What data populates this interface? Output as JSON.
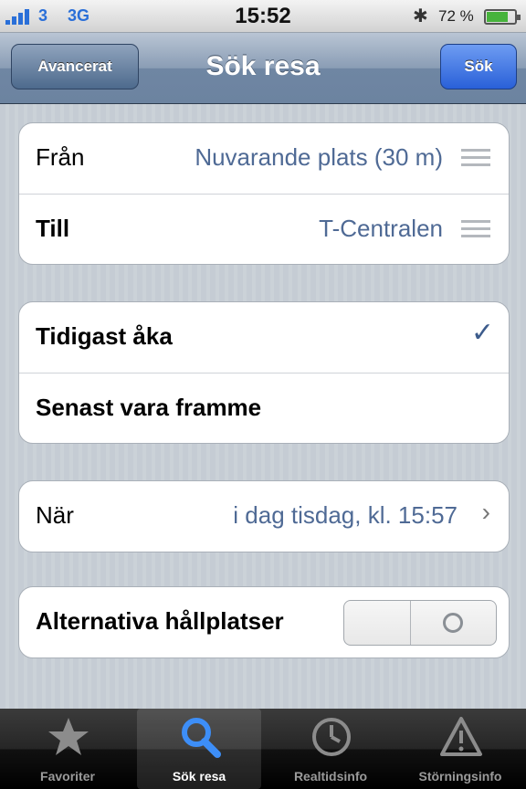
{
  "status": {
    "carrier": "3",
    "network": "3G",
    "time": "15:52",
    "battery": "72 %"
  },
  "nav": {
    "title": "Sök resa",
    "advanced_label": "Avancerat",
    "search_label": "Sök"
  },
  "route": {
    "from_label": "Från",
    "from_value": "Nuvarande plats (30 m)",
    "to_label": "Till",
    "to_value": "T-Centralen"
  },
  "mode": {
    "earliest_label": "Tidigast åka",
    "latest_label": "Senast vara framme",
    "selected": "earliest"
  },
  "when": {
    "label": "När",
    "value": "i dag tisdag, kl. 15:57"
  },
  "alternatives": {
    "label": "Alternativa hållplatser",
    "toggle": "off"
  },
  "tabs": [
    {
      "label": "Favoriter",
      "icon": "star-icon"
    },
    {
      "label": "Sök resa",
      "icon": "search-icon",
      "active": true
    },
    {
      "label": "Realtidsinfo",
      "icon": "clock-icon"
    },
    {
      "label": "Störningsinfo",
      "icon": "warning-icon"
    }
  ],
  "colors": {
    "accent_blue": "#2960d8",
    "value_text": "#4f6a95",
    "battery_green": "#47b33c"
  }
}
